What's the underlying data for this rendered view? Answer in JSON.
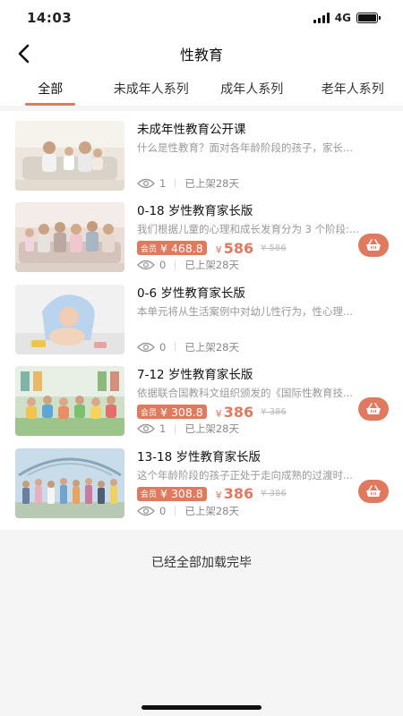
{
  "status_bar": {
    "time": "14:03",
    "network": "4G"
  },
  "header": {
    "title": "性教育"
  },
  "tabs": [
    {
      "label": "全部",
      "active": true
    },
    {
      "label": "未成年人系列",
      "active": false
    },
    {
      "label": "成年人系列",
      "active": false
    },
    {
      "label": "老年人系列",
      "active": false
    }
  ],
  "courses": [
    {
      "title": "未成年性教育公开课",
      "desc": "什么是性教育？面对各年龄阶段的孩子，家长...",
      "views": "1",
      "listed": "已上架28天"
    },
    {
      "title": "0-18 岁性教育家长版",
      "desc": "我们根据儿童的心理和成长发育分为 3 个阶段:...",
      "member_tag": "会员",
      "member_price": "¥ 468.8",
      "currency": "¥",
      "price": "586",
      "original_price": "¥ 586",
      "views": "0",
      "listed": "已上架28天"
    },
    {
      "title": "0-6 岁性教育家长版",
      "desc": "本单元将从生活案例中对幼儿性行为，性心理...",
      "views": "0",
      "listed": "已上架28天"
    },
    {
      "title": "7-12 岁性教育家长版",
      "desc": "依据联合国教科文组织颁发的《国际性教育技...",
      "member_tag": "会员",
      "member_price": "¥ 308.8",
      "currency": "¥",
      "price": "386",
      "original_price": "¥ 386",
      "views": "1",
      "listed": "已上架28天"
    },
    {
      "title": "13-18 岁性教育家长版",
      "desc": "这个年龄阶段的孩子正处于走向成熟的过渡时...",
      "member_tag": "会员",
      "member_price": "¥ 308.8",
      "currency": "¥",
      "price": "386",
      "original_price": "¥ 386",
      "views": "0",
      "listed": "已上架28天"
    }
  ],
  "footer": {
    "text": "已经全部加载完毕"
  },
  "colors": {
    "accent": "#e07a5f",
    "background": "#f5f5f5"
  }
}
